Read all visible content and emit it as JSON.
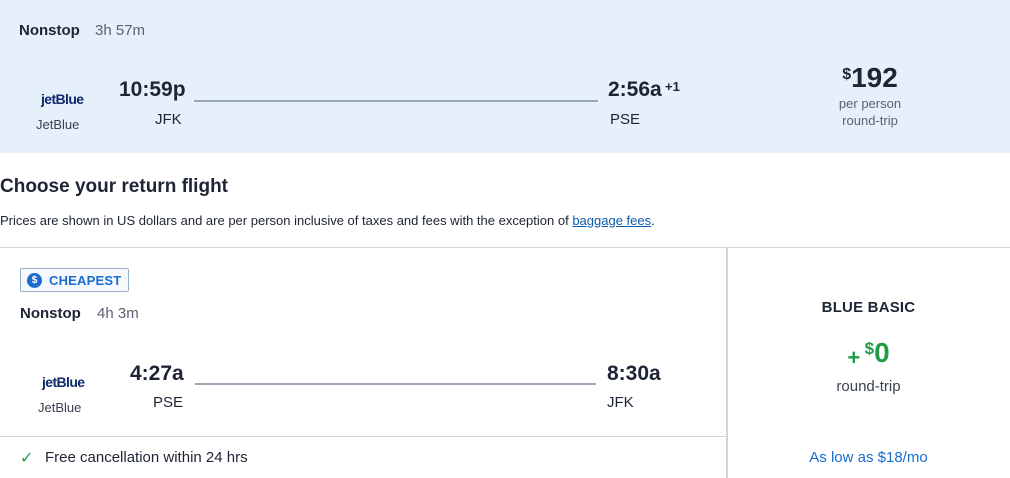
{
  "outbound": {
    "stops": "Nonstop",
    "duration": "3h 57m",
    "logo_text": "jetBlue",
    "airline": "JetBlue",
    "depart_time": "10:59p",
    "depart_airport": "JFK",
    "arrive_time": "2:56a",
    "arrive_day_offset": "+1",
    "arrive_airport": "PSE",
    "price_currency": "$",
    "price_value": "192",
    "price_unit": "per person",
    "price_trip": "round-trip"
  },
  "heading": "Choose your return flight",
  "notice": {
    "text": "Prices are shown in US dollars and are per person inclusive of taxes and fees with the exception of ",
    "link": "baggage fees",
    "end": "."
  },
  "return_flight": {
    "badge_icon": "$",
    "badge": "CHEAPEST",
    "stops": "Nonstop",
    "duration": "4h 3m",
    "logo_text": "jetBlue",
    "airline": "JetBlue",
    "depart_time": "4:27a",
    "depart_airport": "PSE",
    "arrive_time": "8:30a",
    "arrive_airport": "JFK",
    "perk_icon": "✓",
    "perk": "Free cancellation within 24 hrs"
  },
  "fare": {
    "name": "BLUE BASIC",
    "plus": "+",
    "currency": "$",
    "value": "0",
    "trip": "round-trip",
    "monthly": "As low as $18/mo"
  },
  "colors": {
    "banner_bg": "#e6f0fb",
    "accent_blue": "#1a6ccf",
    "price_green": "#1f9d45"
  }
}
